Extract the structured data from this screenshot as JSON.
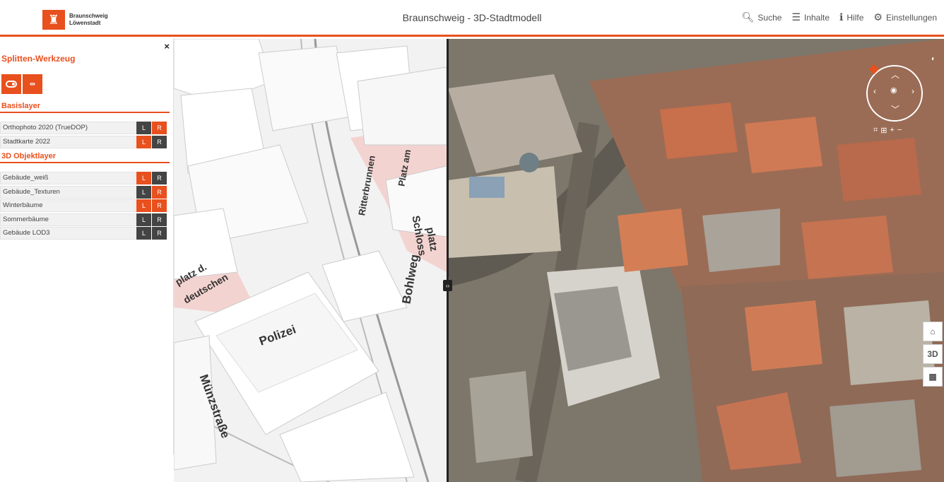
{
  "header": {
    "logo_line1": "Braunschweig",
    "logo_line2": "Löwenstadt",
    "title": "Braunschweig - 3D-Stadtmodell",
    "menu": [
      {
        "label": "Suche",
        "icon": "search-icon"
      },
      {
        "label": "Inhalte",
        "icon": "list-icon"
      },
      {
        "label": "Hilfe",
        "icon": "info-icon"
      },
      {
        "label": "Einstellungen",
        "icon": "gear-icon"
      }
    ]
  },
  "panel": {
    "title": "Splitten-Werkzeug",
    "close_label": "×",
    "sections": [
      {
        "title": "Basislayer",
        "layers": [
          {
            "name": "Orthophoto 2020 (TrueDOP)",
            "left": false,
            "right": true
          },
          {
            "name": "Stadtkarte 2022",
            "left": true,
            "right": false
          }
        ]
      },
      {
        "title": "3D Objektlayer",
        "layers": [
          {
            "name": "Gebäude_weiß",
            "left": true,
            "right": false
          },
          {
            "name": "Gebäude_Texturen",
            "left": false,
            "right": true
          },
          {
            "name": "Winterbäume",
            "left": true,
            "right": true
          },
          {
            "name": "Sommerbäume",
            "left": false,
            "right": false
          },
          {
            "name": "Gebäude LOD3",
            "left": false,
            "right": false
          }
        ]
      }
    ],
    "btn_left": "L",
    "btn_right": "R"
  },
  "map_labels": {
    "polizei": "Polizei",
    "bohlweg": "Bohlweg",
    "muenzstrasse": "Münzstraße",
    "schlossplatz_1": "Schloss",
    "schlossplatz_2": "platz",
    "ritterbrunnen": "Ritterbrunnen",
    "ritterbrunnen_2": "Platz am",
    "platz_deutschen_1": "platz d.",
    "platz_deutschen_2": "deutschen"
  },
  "side_controls": {
    "threed_label": "3D"
  },
  "colors": {
    "accent": "#e8501e",
    "dark_button": "#444444"
  }
}
